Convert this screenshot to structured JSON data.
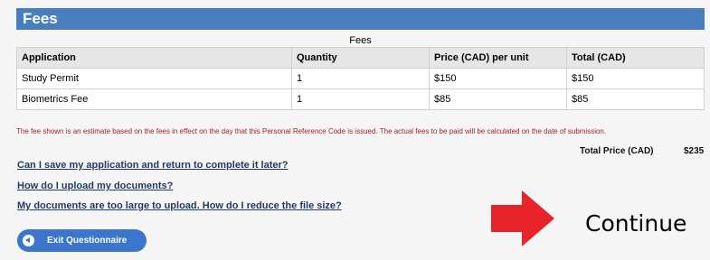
{
  "section": {
    "title": "Fees"
  },
  "table": {
    "caption": "Fees",
    "headers": [
      "Application",
      "Quantity",
      "Price (CAD) per unit",
      "Total (CAD)"
    ],
    "rows": [
      [
        "Study Permit",
        "1",
        "$150",
        "$150"
      ],
      [
        "Biometrics Fee",
        "1",
        "$85",
        "$85"
      ]
    ]
  },
  "disclaimer": "The fee shown is an estimate based on the fees in effect on the day that this Personal Reference Code is issued. The actual fees to be paid will be calculated on the date of submission.",
  "total": {
    "label": "Total Price (CAD)",
    "value": "$235"
  },
  "help_links": [
    "Can I save my application and return to complete it later?",
    "How do I upload my documents?",
    "My documents are too large to upload. How do I reduce the file size?"
  ],
  "exit_button": {
    "label": "Exit Questionnaire",
    "icon": "arrow-left-circle-icon"
  },
  "continue": {
    "label": "Continue",
    "arrow_color": "#e8232a",
    "icon": "arrow-right-icon"
  },
  "colors": {
    "header": "#4a7fbf",
    "button": "#3b76cc",
    "disclaimer": "#9b1d1d"
  }
}
